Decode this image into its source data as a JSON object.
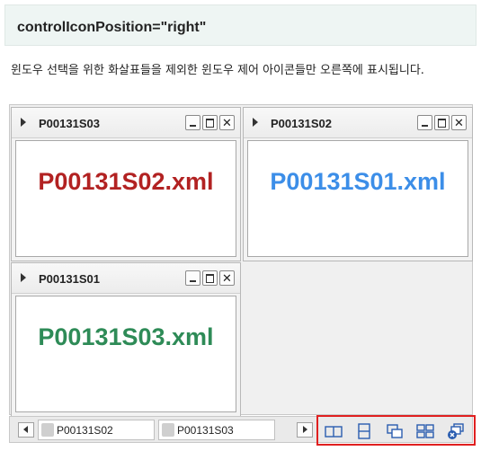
{
  "header": {
    "title": "controlIconPosition=\"right\""
  },
  "description": "윈도우 선택을 위한 화살표들을 제외한 윈도우 제어 아이콘들만 오른쪽에 표시됩니다.",
  "windows": [
    {
      "title": "P00131S03",
      "content": "P00131S02.xml",
      "color": "#b22222"
    },
    {
      "title": "P00131S02",
      "content": "P00131S01.xml",
      "color": "#3c8ee8"
    },
    {
      "title": "P00131S01",
      "content": "P00131S03.xml",
      "color": "#2e8b57"
    }
  ],
  "window_controls": {
    "close": "✕"
  },
  "taskbar": {
    "tabs": [
      {
        "label": "P00131S02"
      },
      {
        "label": "P00131S03"
      }
    ],
    "icons": [
      "cascade-horizontal-icon",
      "tile-vertical-icon",
      "cascade-icon",
      "tile-grid-icon",
      "close-all-icon"
    ]
  },
  "colors": {
    "highlight_border": "#e02020",
    "icon_blue": "#2a5db0"
  }
}
